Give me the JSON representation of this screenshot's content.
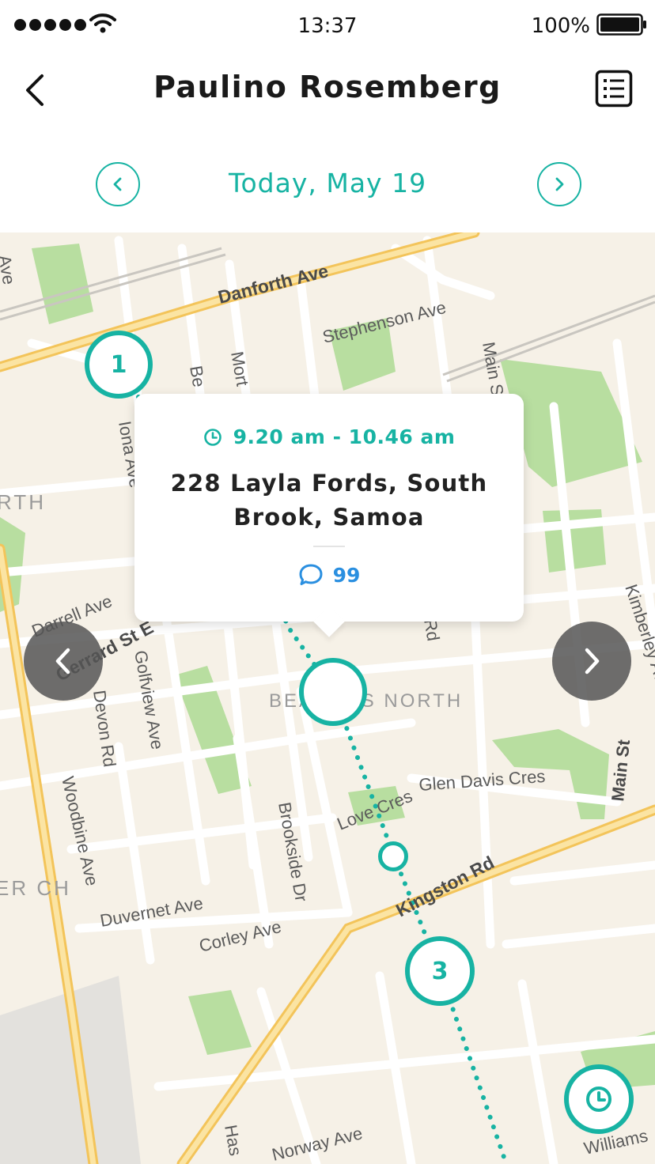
{
  "status_bar": {
    "time": "13:37",
    "battery_percent": "100%"
  },
  "header": {
    "title": "Paulino Rosemberg"
  },
  "date_nav": {
    "label": "Today, May 19"
  },
  "map": {
    "street_labels": [
      "Danforth Ave",
      "Stephenson Ave",
      "Main St",
      "Iona Ave",
      "RTH",
      "Darrell Ave",
      "Gerrard St E",
      "Golfview Ave",
      "Devon Rd",
      "Woodbine Ave",
      "BEACHES NORTH",
      "Glen Davis Cres",
      "Love Cres",
      "Brookside Dr",
      "Kingston Rd",
      "Duvernet Ave",
      "Corley Ave",
      "ER CH",
      "Norway Ave",
      "Williams",
      "Kimberley Ave",
      "Main St",
      "Rd",
      "Has",
      "Be",
      "Mort",
      "Ave"
    ],
    "stops": {
      "first": "1",
      "third": "3"
    }
  },
  "popup": {
    "time_range": "9.20 am - 10.46 am",
    "address": "228 Layla Fords, South Brook, Samoa",
    "comment_count": "99"
  },
  "colors": {
    "accent": "#17b3a3",
    "comment": "#2a8fe0",
    "park": "#b8dea0",
    "road_major": "#f7d67a"
  },
  "icons": [
    "back-icon",
    "list-icon",
    "chevron-left-icon",
    "chevron-right-icon",
    "clock-icon",
    "comment-icon"
  ]
}
